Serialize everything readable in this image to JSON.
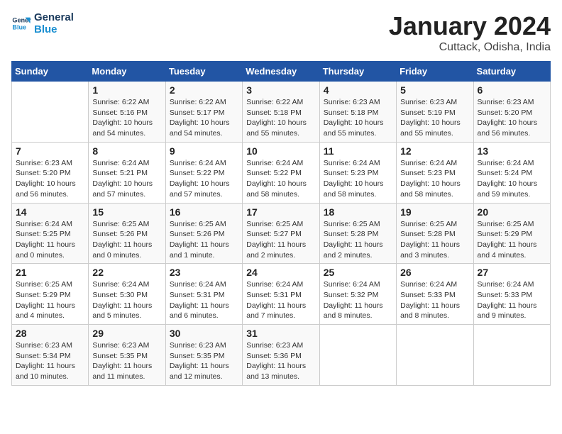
{
  "logo": {
    "line1": "General",
    "line2": "Blue"
  },
  "title": "January 2024",
  "location": "Cuttack, Odisha, India",
  "days_of_week": [
    "Sunday",
    "Monday",
    "Tuesday",
    "Wednesday",
    "Thursday",
    "Friday",
    "Saturday"
  ],
  "weeks": [
    [
      {
        "day": "",
        "info": ""
      },
      {
        "day": "1",
        "info": "Sunrise: 6:22 AM\nSunset: 5:16 PM\nDaylight: 10 hours\nand 54 minutes."
      },
      {
        "day": "2",
        "info": "Sunrise: 6:22 AM\nSunset: 5:17 PM\nDaylight: 10 hours\nand 54 minutes."
      },
      {
        "day": "3",
        "info": "Sunrise: 6:22 AM\nSunset: 5:18 PM\nDaylight: 10 hours\nand 55 minutes."
      },
      {
        "day": "4",
        "info": "Sunrise: 6:23 AM\nSunset: 5:18 PM\nDaylight: 10 hours\nand 55 minutes."
      },
      {
        "day": "5",
        "info": "Sunrise: 6:23 AM\nSunset: 5:19 PM\nDaylight: 10 hours\nand 55 minutes."
      },
      {
        "day": "6",
        "info": "Sunrise: 6:23 AM\nSunset: 5:20 PM\nDaylight: 10 hours\nand 56 minutes."
      }
    ],
    [
      {
        "day": "7",
        "info": "Sunrise: 6:23 AM\nSunset: 5:20 PM\nDaylight: 10 hours\nand 56 minutes."
      },
      {
        "day": "8",
        "info": "Sunrise: 6:24 AM\nSunset: 5:21 PM\nDaylight: 10 hours\nand 57 minutes."
      },
      {
        "day": "9",
        "info": "Sunrise: 6:24 AM\nSunset: 5:22 PM\nDaylight: 10 hours\nand 57 minutes."
      },
      {
        "day": "10",
        "info": "Sunrise: 6:24 AM\nSunset: 5:22 PM\nDaylight: 10 hours\nand 58 minutes."
      },
      {
        "day": "11",
        "info": "Sunrise: 6:24 AM\nSunset: 5:23 PM\nDaylight: 10 hours\nand 58 minutes."
      },
      {
        "day": "12",
        "info": "Sunrise: 6:24 AM\nSunset: 5:23 PM\nDaylight: 10 hours\nand 58 minutes."
      },
      {
        "day": "13",
        "info": "Sunrise: 6:24 AM\nSunset: 5:24 PM\nDaylight: 10 hours\nand 59 minutes."
      }
    ],
    [
      {
        "day": "14",
        "info": "Sunrise: 6:24 AM\nSunset: 5:25 PM\nDaylight: 11 hours\nand 0 minutes."
      },
      {
        "day": "15",
        "info": "Sunrise: 6:25 AM\nSunset: 5:26 PM\nDaylight: 11 hours\nand 0 minutes."
      },
      {
        "day": "16",
        "info": "Sunrise: 6:25 AM\nSunset: 5:26 PM\nDaylight: 11 hours\nand 1 minute."
      },
      {
        "day": "17",
        "info": "Sunrise: 6:25 AM\nSunset: 5:27 PM\nDaylight: 11 hours\nand 2 minutes."
      },
      {
        "day": "18",
        "info": "Sunrise: 6:25 AM\nSunset: 5:28 PM\nDaylight: 11 hours\nand 2 minutes."
      },
      {
        "day": "19",
        "info": "Sunrise: 6:25 AM\nSunset: 5:28 PM\nDaylight: 11 hours\nand 3 minutes."
      },
      {
        "day": "20",
        "info": "Sunrise: 6:25 AM\nSunset: 5:29 PM\nDaylight: 11 hours\nand 4 minutes."
      }
    ],
    [
      {
        "day": "21",
        "info": "Sunrise: 6:25 AM\nSunset: 5:29 PM\nDaylight: 11 hours\nand 4 minutes."
      },
      {
        "day": "22",
        "info": "Sunrise: 6:24 AM\nSunset: 5:30 PM\nDaylight: 11 hours\nand 5 minutes."
      },
      {
        "day": "23",
        "info": "Sunrise: 6:24 AM\nSunset: 5:31 PM\nDaylight: 11 hours\nand 6 minutes."
      },
      {
        "day": "24",
        "info": "Sunrise: 6:24 AM\nSunset: 5:31 PM\nDaylight: 11 hours\nand 7 minutes."
      },
      {
        "day": "25",
        "info": "Sunrise: 6:24 AM\nSunset: 5:32 PM\nDaylight: 11 hours\nand 8 minutes."
      },
      {
        "day": "26",
        "info": "Sunrise: 6:24 AM\nSunset: 5:33 PM\nDaylight: 11 hours\nand 8 minutes."
      },
      {
        "day": "27",
        "info": "Sunrise: 6:24 AM\nSunset: 5:33 PM\nDaylight: 11 hours\nand 9 minutes."
      }
    ],
    [
      {
        "day": "28",
        "info": "Sunrise: 6:23 AM\nSunset: 5:34 PM\nDaylight: 11 hours\nand 10 minutes."
      },
      {
        "day": "29",
        "info": "Sunrise: 6:23 AM\nSunset: 5:35 PM\nDaylight: 11 hours\nand 11 minutes."
      },
      {
        "day": "30",
        "info": "Sunrise: 6:23 AM\nSunset: 5:35 PM\nDaylight: 11 hours\nand 12 minutes."
      },
      {
        "day": "31",
        "info": "Sunrise: 6:23 AM\nSunset: 5:36 PM\nDaylight: 11 hours\nand 13 minutes."
      },
      {
        "day": "",
        "info": ""
      },
      {
        "day": "",
        "info": ""
      },
      {
        "day": "",
        "info": ""
      }
    ]
  ]
}
